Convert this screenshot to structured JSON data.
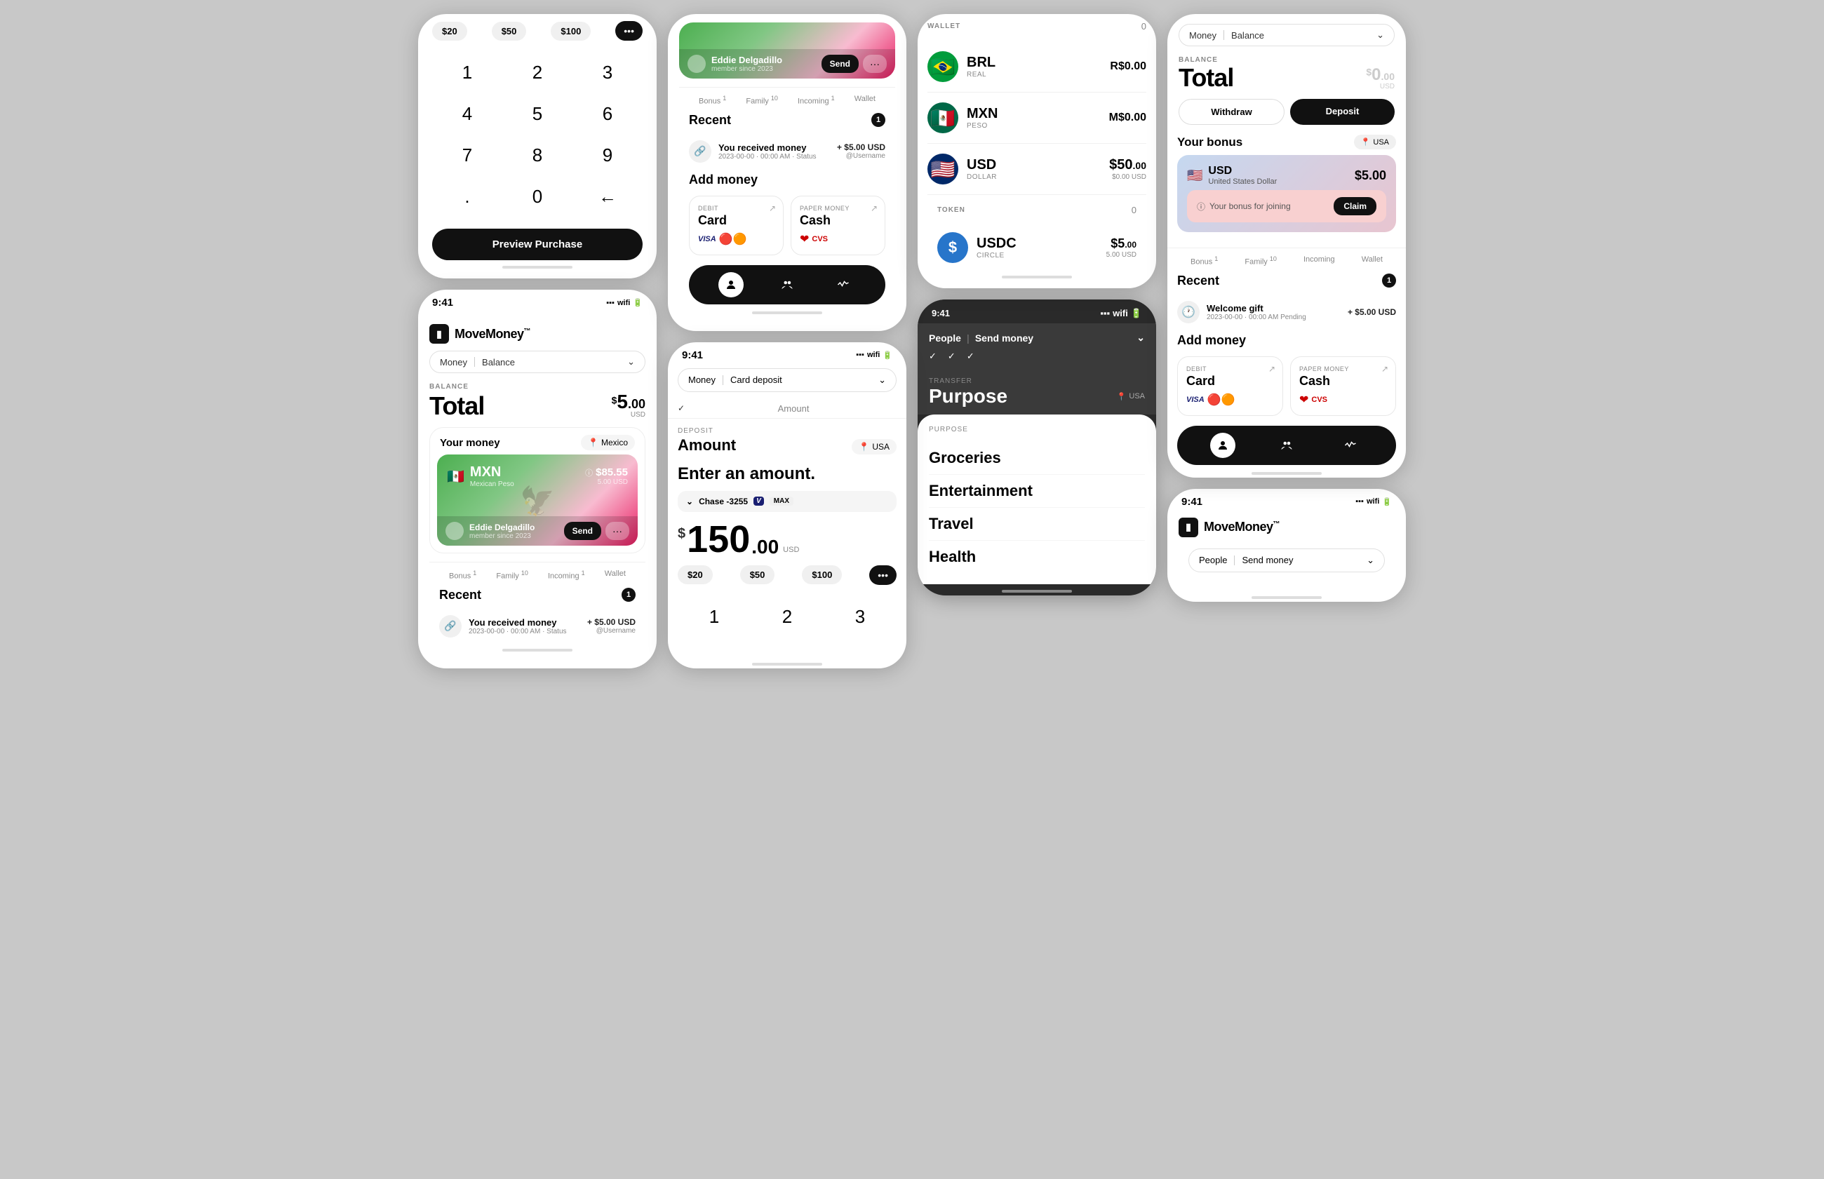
{
  "app": {
    "name": "MoveMoney",
    "tm": "™",
    "time": "9:41"
  },
  "screens": {
    "phone1": {
      "type": "numpad_partial",
      "presets": [
        "$20",
        "$50",
        "$100"
      ],
      "keys": [
        "1",
        "2",
        "3",
        "4",
        "5",
        "6",
        "7",
        "8",
        "9",
        ".",
        "0",
        "←"
      ],
      "preview_label": "Preview Purchase"
    },
    "phone2": {
      "type": "main_balance",
      "selector": {
        "left": "Money",
        "right": "Balance"
      },
      "balance_label": "BALANCE",
      "balance_title": "Total",
      "balance_amount": "$5",
      "balance_dec": ".00",
      "balance_currency": "USD",
      "your_money": "Your money",
      "location": "Mexico",
      "currency_code": "MXN",
      "currency_name": "Mexican Peso",
      "currency_flag": "🇲🇽",
      "currency_amount": "$85.55",
      "currency_usd": "5.00 USD",
      "user_name": "Eddie Delgadillo",
      "user_since": "member since 2023",
      "tabs": [
        "Bonus 1",
        "Family 10",
        "Incoming 1",
        "Wallet"
      ],
      "recent_title": "Recent",
      "recent_count": "1",
      "recent_item": {
        "title": "You received money",
        "date": "2023-00-00 · 00:00 AM · Status",
        "amount": "+ $5.00 USD",
        "user": "@Username"
      }
    },
    "phone3": {
      "type": "send_receive",
      "user_name": "Eddie Delgadillo",
      "user_since": "member since 2023",
      "tabs": [
        "Bonus 1",
        "Family 10",
        "Incoming 1",
        "Wallet"
      ],
      "recent_title": "Recent",
      "recent_count": "1",
      "recent_item": {
        "title": "You received money",
        "date": "2023-00-00 · 00:00 AM · Status",
        "amount": "+ $5.00 USD",
        "user": "@Username"
      },
      "add_money_title": "Add money",
      "card_deposit": {
        "label": "DEBIT",
        "title": "Card",
        "logos": "VISA MC"
      },
      "cash_deposit": {
        "label": "PAPER MONEY",
        "title": "Cash",
        "logos": "CVS"
      }
    },
    "phone4": {
      "type": "wallet",
      "wallet_label": "WALLET",
      "wallet_count": "0",
      "currencies": [
        {
          "flag": "🇧🇷",
          "code": "BRL",
          "name": "REAL",
          "main": "R$0.00",
          "usd": ""
        },
        {
          "flag": "🇲🇽",
          "code": "MXN",
          "name": "PESO",
          "main": "M$0.00",
          "usd": ""
        },
        {
          "flag": "🇺🇸",
          "code": "USD",
          "name": "DOLLAR",
          "main": "$50.00",
          "usd": "$0.00 USD"
        }
      ],
      "token_label": "TOKEN",
      "token_count": "0",
      "tokens": [
        {
          "code": "USDC",
          "name": "CIRCLE",
          "main": "$5.00",
          "usd": "5.00 USD"
        }
      ]
    },
    "phone5": {
      "type": "card_deposit",
      "selector": {
        "left": "Money",
        "right": "Card deposit"
      },
      "amount_label": "DEPOSIT",
      "amount_title": "Amount",
      "location": "USA",
      "prompt": "Enter an amount.",
      "card": "Chase -3255",
      "amount_main": "$150",
      "amount_dec": ".00",
      "amount_currency": "USD",
      "presets": [
        "$20",
        "$50",
        "$100"
      ],
      "keys": [
        "1",
        "2",
        "3"
      ]
    },
    "phone6": {
      "type": "purpose",
      "selector": {
        "left": "People",
        "right": "Send money"
      },
      "checks": [
        "✓",
        "✓",
        "✓"
      ],
      "purpose_field": "Purpose",
      "transfer_label": "TRANSFER",
      "location": "USA",
      "purpose_label": "PURPOSE",
      "items": [
        "Groceries",
        "Entertainment",
        "Travel",
        "Health"
      ]
    },
    "phone7": {
      "type": "main_balance_zero",
      "selector": {
        "left": "Money",
        "right": "Balance"
      },
      "balance_label": "BALANCE",
      "balance_title": "Total",
      "balance_amount": "$0",
      "balance_dec": ".00",
      "balance_currency": "USD",
      "withdraw_label": "Withdraw",
      "deposit_label": "Deposit",
      "bonus_title": "Your bonus",
      "location": "USA",
      "bonus_currency": "USD",
      "bonus_currency_full": "United States Dollar",
      "bonus_amount": "$5.00",
      "bonus_claim_text": "Your bonus for joining",
      "claim_btn": "Claim",
      "tabs": [
        "Bonus 1",
        "Family 10",
        "Incoming",
        "Wallet"
      ],
      "recent_title": "Recent",
      "recent_count": "1",
      "recent_item": {
        "title": "Welcome gift",
        "date": "2023-00-00 · 00:00 AM",
        "status": "Pending",
        "amount": "+ $5.00 USD"
      },
      "add_money_title": "Add money",
      "card_deposit": {
        "label": "DEBIT",
        "title": "Card",
        "logos": "VISA MC"
      },
      "cash_deposit": {
        "label": "PAPER MONEY",
        "title": "Cash",
        "logos": "CVS"
      }
    },
    "phone8": {
      "type": "people_send",
      "selector": {
        "left": "People",
        "right": "Send money"
      }
    }
  }
}
